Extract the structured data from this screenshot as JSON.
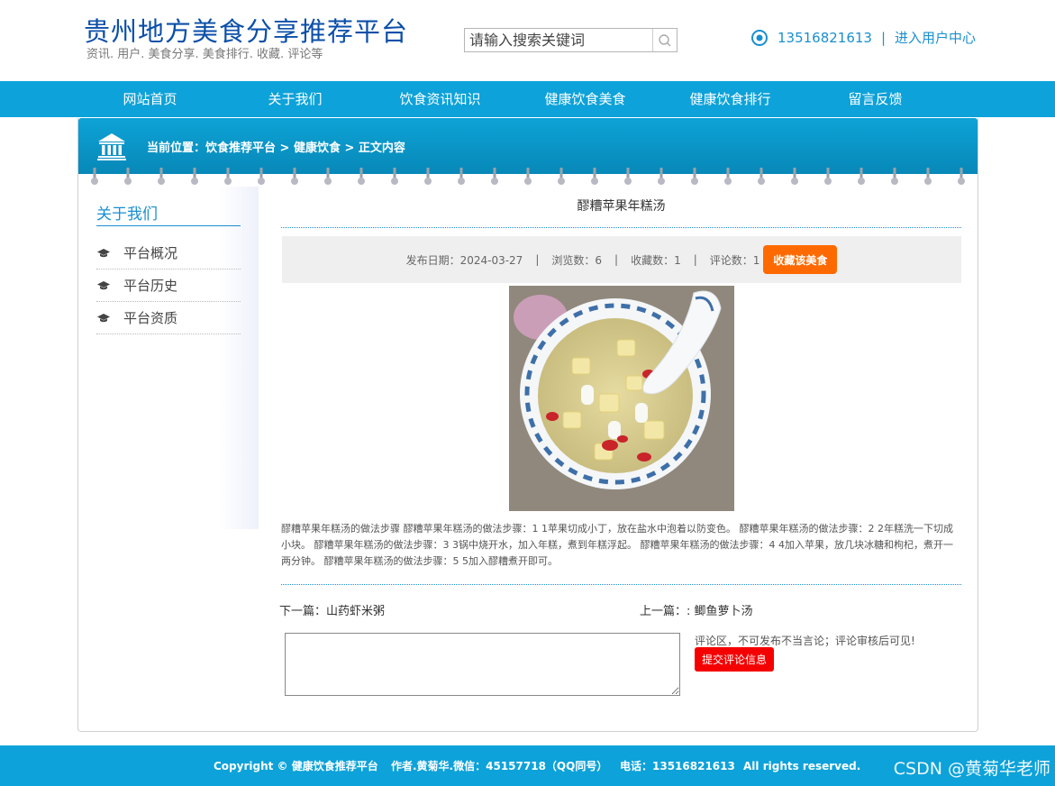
{
  "header": {
    "title": "贵州地方美食分享推荐平台",
    "subtitle": "资讯. 用户. 美食分享. 美食排行. 收藏. 评论等",
    "search_placeholder": "请输入搜索关键词",
    "phone": "13516821613",
    "separator": "|",
    "user_center": "进入用户中心"
  },
  "nav": [
    "网站首页",
    "关于我们",
    "饮食资讯知识",
    "健康饮食美食",
    "健康饮食排行",
    "留言反馈"
  ],
  "breadcrumb": "当前位置：饮食推荐平台 > 健康饮食 > 正文内容",
  "sidebar": {
    "title": "关于我们",
    "items": [
      "平台概况",
      "平台历史",
      "平台资质"
    ]
  },
  "article": {
    "title": "醪糟苹果年糕汤",
    "publish_date": "发布日期：2024-03-27",
    "views": "浏览数：6",
    "favorites": "收藏数：1",
    "comments": "评论数：1",
    "meta_separator": "|",
    "favorite_button": "收藏该美食",
    "body": "醪糟苹果年糕汤的做法步骤 醪糟苹果年糕汤的做法步骤：1 1苹果切成小丁，放在盐水中泡着以防变色。 醪糟苹果年糕汤的做法步骤：2 2年糕洗一下切成小块。 醪糟苹果年糕汤的做法步骤：3 3锅中烧开水，加入年糕，煮到年糕浮起。 醪糟苹果年糕汤的做法步骤：4 4加入苹果，放几块冰糖和枸杞，煮开一两分钟。 醪糟苹果年糕汤的做法步骤：5 5加入醪糟煮开即可。",
    "next": "下一篇：山药虾米粥",
    "prev": "上一篇：: 鲫鱼萝卜汤"
  },
  "comment": {
    "note": "评论区，不可发布不当言论；评论审核后可见!",
    "submit": "提交评论信息"
  },
  "footer": {
    "copyright": "Copyright © 健康饮食推荐平台",
    "author": "作者.黄菊华.微信：45157718（QQ同号）",
    "phone": "电话：13516821613",
    "rights": "All rights reserved."
  },
  "watermark": "CSDN @黄菊华老师",
  "colors": {
    "nav": "#0da2d9",
    "brand": "#0b4fa8",
    "accent": "#1a8fd0",
    "favorite": "#ff6a00",
    "submit": "#f40000"
  }
}
